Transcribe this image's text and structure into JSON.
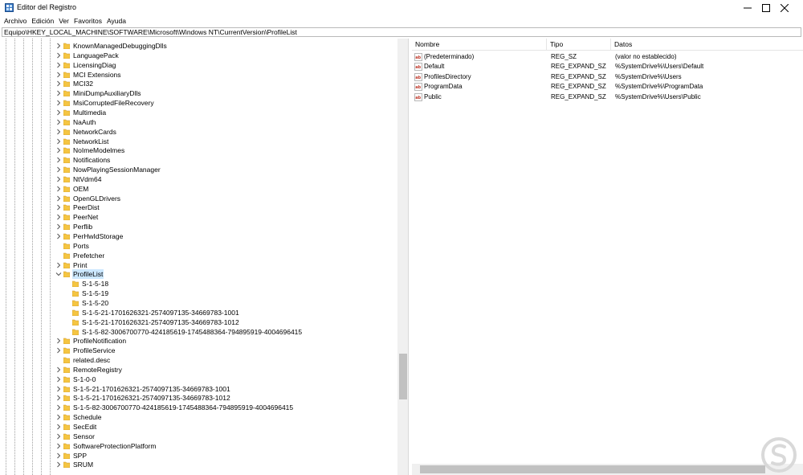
{
  "window": {
    "title": "Editor del Registro",
    "controls": [
      "minimize",
      "maximize",
      "close"
    ]
  },
  "menu": [
    "Archivo",
    "Edición",
    "Ver",
    "Favoritos",
    "Ayuda"
  ],
  "address": "Equipo\\HKEY_LOCAL_MACHINE\\SOFTWARE\\Microsoft\\Windows NT\\CurrentVersion\\ProfileList",
  "tree": {
    "items": [
      {
        "label": "KnownManagedDebuggingDlls",
        "level": 0,
        "expandable": true
      },
      {
        "label": "LanguagePack",
        "level": 0,
        "expandable": true
      },
      {
        "label": "LicensingDiag",
        "level": 0,
        "expandable": true
      },
      {
        "label": "MCI Extensions",
        "level": 0,
        "expandable": true
      },
      {
        "label": "MCI32",
        "level": 0,
        "expandable": true
      },
      {
        "label": "MiniDumpAuxiliaryDlls",
        "level": 0,
        "expandable": true
      },
      {
        "label": "MsiCorruptedFileRecovery",
        "level": 0,
        "expandable": true
      },
      {
        "label": "Multimedia",
        "level": 0,
        "expandable": true
      },
      {
        "label": "NaAuth",
        "level": 0,
        "expandable": true
      },
      {
        "label": "NetworkCards",
        "level": 0,
        "expandable": true
      },
      {
        "label": "NetworkList",
        "level": 0,
        "expandable": true
      },
      {
        "label": "NoImeModelmes",
        "level": 0,
        "expandable": true
      },
      {
        "label": "Notifications",
        "level": 0,
        "expandable": true
      },
      {
        "label": "NowPlayingSessionManager",
        "level": 0,
        "expandable": true
      },
      {
        "label": "NtVdm64",
        "level": 0,
        "expandable": true
      },
      {
        "label": "OEM",
        "level": 0,
        "expandable": true
      },
      {
        "label": "OpenGLDrivers",
        "level": 0,
        "expandable": true
      },
      {
        "label": "PeerDist",
        "level": 0,
        "expandable": true
      },
      {
        "label": "PeerNet",
        "level": 0,
        "expandable": true
      },
      {
        "label": "Perflib",
        "level": 0,
        "expandable": true
      },
      {
        "label": "PerHwIdStorage",
        "level": 0,
        "expandable": true
      },
      {
        "label": "Ports",
        "level": 0,
        "expandable": false
      },
      {
        "label": "Prefetcher",
        "level": 0,
        "expandable": false
      },
      {
        "label": "Print",
        "level": 0,
        "expandable": true
      },
      {
        "label": "ProfileList",
        "level": 0,
        "expandable": true,
        "expanded": true,
        "selected": true
      },
      {
        "label": "S-1-5-18",
        "level": 1,
        "expandable": false
      },
      {
        "label": "S-1-5-19",
        "level": 1,
        "expandable": false
      },
      {
        "label": "S-1-5-20",
        "level": 1,
        "expandable": false
      },
      {
        "label": "S-1-5-21-1701626321-2574097135-34669783-1001",
        "level": 1,
        "expandable": false
      },
      {
        "label": "S-1-5-21-1701626321-2574097135-34669783-1012",
        "level": 1,
        "expandable": false
      },
      {
        "label": "S-1-5-82-3006700770-424185619-1745488364-794895919-4004696415",
        "level": 1,
        "expandable": false
      },
      {
        "label": "ProfileNotification",
        "level": 0,
        "expandable": true
      },
      {
        "label": "ProfileService",
        "level": 0,
        "expandable": true
      },
      {
        "label": "related.desc",
        "level": 0,
        "expandable": false
      },
      {
        "label": "RemoteRegistry",
        "level": 0,
        "expandable": true
      },
      {
        "label": "S-1-0-0",
        "level": 0,
        "expandable": true
      },
      {
        "label": "S-1-5-21-1701626321-2574097135-34669783-1001",
        "level": 0,
        "expandable": true
      },
      {
        "label": "S-1-5-21-1701626321-2574097135-34669783-1012",
        "level": 0,
        "expandable": true
      },
      {
        "label": "S-1-5-82-3006700770-424185619-1745488364-794895919-4004696415",
        "level": 0,
        "expandable": true
      },
      {
        "label": "Schedule",
        "level": 0,
        "expandable": true
      },
      {
        "label": "SecEdit",
        "level": 0,
        "expandable": true
      },
      {
        "label": "Sensor",
        "level": 0,
        "expandable": true
      },
      {
        "label": "SoftwareProtectionPlatform",
        "level": 0,
        "expandable": true
      },
      {
        "label": "SPP",
        "level": 0,
        "expandable": true
      },
      {
        "label": "SRUM",
        "level": 0,
        "expandable": true
      }
    ]
  },
  "list": {
    "columns": [
      "Nombre",
      "Tipo",
      "Datos"
    ],
    "rows": [
      {
        "name": "(Predeterminado)",
        "type": "REG_SZ",
        "data": "(valor no establecido)"
      },
      {
        "name": "Default",
        "type": "REG_EXPAND_SZ",
        "data": "%SystemDrive%\\Users\\Default"
      },
      {
        "name": "ProfilesDirectory",
        "type": "REG_EXPAND_SZ",
        "data": "%SystemDrive%\\Users"
      },
      {
        "name": "ProgramData",
        "type": "REG_EXPAND_SZ",
        "data": "%SystemDrive%\\ProgramData"
      },
      {
        "name": "Public",
        "type": "REG_EXPAND_SZ",
        "data": "%SystemDrive%\\Users\\Public"
      }
    ]
  },
  "colors": {
    "folder": "#f5c542",
    "selection": "#cce8ff",
    "scrollbar_track": "#f0f0f0",
    "scrollbar_thumb": "#c1c1c1",
    "watermark": "#d9d9d9"
  }
}
